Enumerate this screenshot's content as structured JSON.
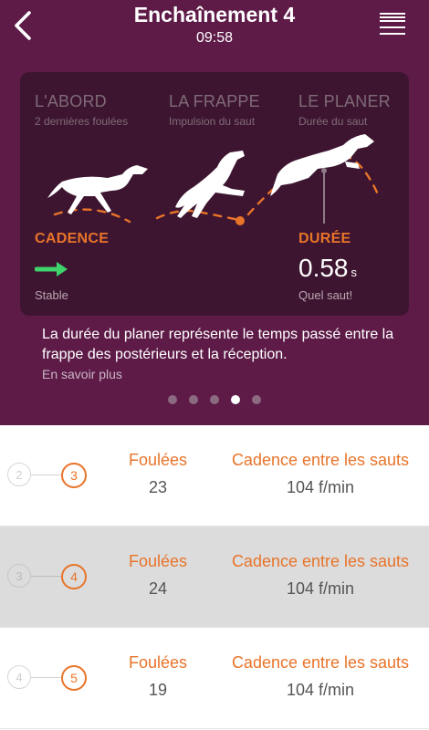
{
  "header": {
    "title": "Enchaînement 4",
    "time": "09:58"
  },
  "phases": [
    {
      "title": "L'ABORD",
      "subtitle": "2 dernières foulées"
    },
    {
      "title": "LA FRAPPE",
      "subtitle": "Impulsion du saut"
    },
    {
      "title": "LE PLANER",
      "subtitle": "Durée du saut"
    }
  ],
  "cadence": {
    "label": "CADENCE",
    "note": "Stable"
  },
  "duree": {
    "label": "DURÉE",
    "value": "0.58",
    "unit": "s",
    "note": "Quel saut!"
  },
  "description": "La durée du planer représente le temps passé entre la frappe des postérieurs et la réception.",
  "learn_more": "En savoir plus",
  "pager": {
    "count": 5,
    "active_index": 3
  },
  "colors": {
    "background": "#5e1b48",
    "card": "#3e1530",
    "accent": "#e8742a",
    "arrow": "#3ed36b"
  },
  "list": {
    "rows": [
      {
        "prev_number": "2",
        "number": "3",
        "foulees_label": "Foulées",
        "foulees": "23",
        "cadence_label": "Cadence entre les sauts",
        "cadence": "104 f/min"
      },
      {
        "prev_number": "3",
        "number": "4",
        "foulees_label": "Foulées",
        "foulees": "24",
        "cadence_label": "Cadence entre les sauts",
        "cadence": "104 f/min"
      },
      {
        "prev_number": "4",
        "number": "5",
        "foulees_label": "Foulées",
        "foulees": "19",
        "cadence_label": "Cadence entre les sauts",
        "cadence": "104 f/min"
      }
    ]
  }
}
